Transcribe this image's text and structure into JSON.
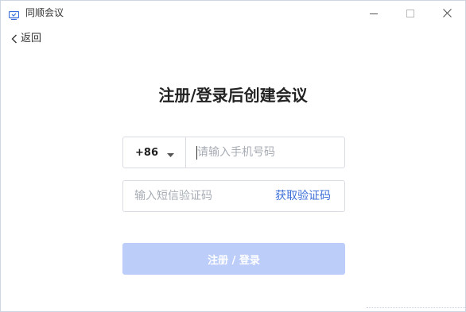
{
  "window": {
    "title": "同顺会议"
  },
  "nav": {
    "back_label": "返回"
  },
  "main": {
    "heading": "注册/登录后创建会议",
    "country_code": "+86",
    "phone_placeholder": "请输入手机号码",
    "phone_value": "",
    "sms_placeholder": "输入短信验证码",
    "sms_value": "",
    "get_code_label": "获取验证码",
    "submit_label": "注册 / 登录"
  },
  "colors": {
    "accent": "#3c6fd9",
    "submit_disabled": "#bccdf9",
    "border": "#d9dde3"
  },
  "icons": {
    "app": "meeting-icon",
    "minimize": "minimize-icon",
    "maximize": "maximize-icon",
    "close": "close-icon",
    "back": "chevron-left-icon",
    "dropdown": "caret-down-icon"
  }
}
